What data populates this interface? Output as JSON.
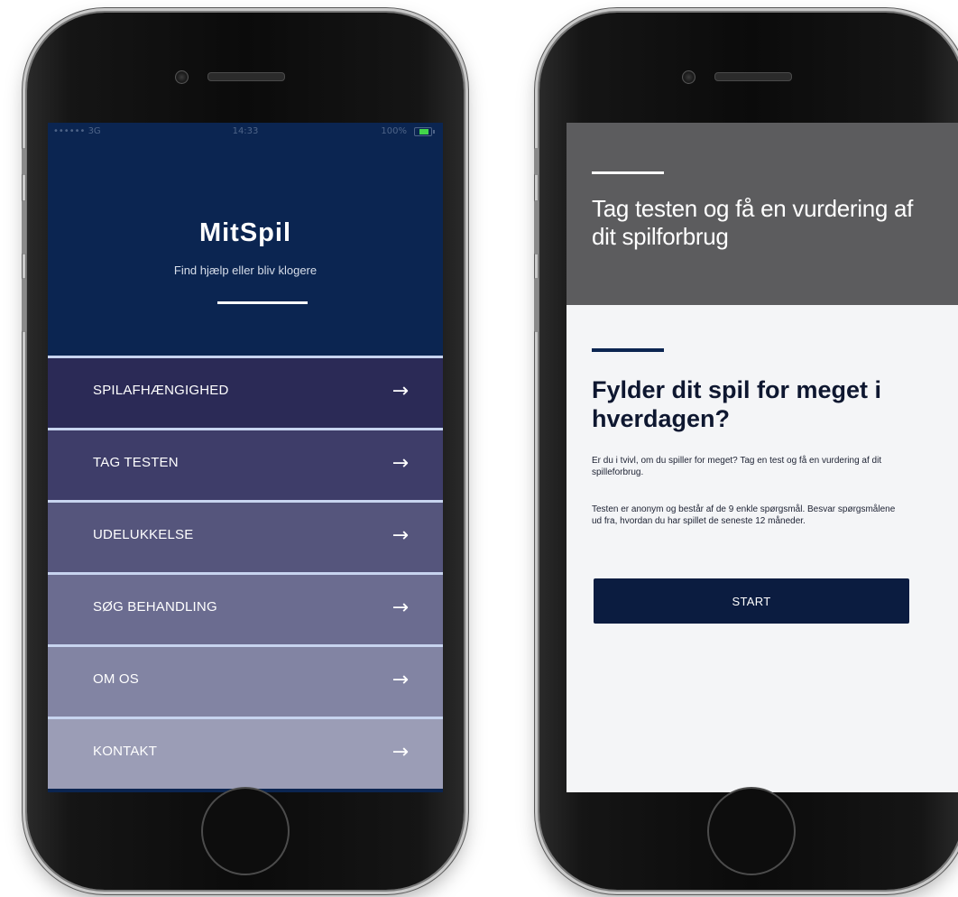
{
  "left_phone": {
    "status_bar": {
      "carrier": "•••••• 3G",
      "time": "14:33",
      "battery_text": "100%"
    },
    "app_title": "MitSpil",
    "app_subtitle": "Find hjælp eller bliv klogere",
    "menu": [
      {
        "label": "SPILAFHÆNGIGHED",
        "arrow": "→",
        "bg": "#2b2a56"
      },
      {
        "label": "TAG TESTEN",
        "arrow": "→",
        "bg": "#3e3d69"
      },
      {
        "label": "UDELUKKELSE",
        "arrow": "→",
        "bg": "#55557c"
      },
      {
        "label": "SØG BEHANDLING",
        "arrow": "→",
        "bg": "#6b6c90"
      },
      {
        "label": "OM OS",
        "arrow": "→",
        "bg": "#8284a3"
      },
      {
        "label": "KONTAKT",
        "arrow": "→",
        "bg": "#9b9db6"
      }
    ]
  },
  "right_phone": {
    "header_title": "Tag testen og få en vurdering af dit spilforbrug",
    "section_heading": "Fylder dit spil for meget i hverdagen?",
    "paragraph_1": "Er du i tvivl, om du spiller for meget? Tag en test og få en vurdering af dit spilleforbrug.",
    "paragraph_2": "Testen er anonym og består af de 9 enkle spørgsmål. Besvar spørgsmålene ud fra, hvordan du har spillet de seneste 12 måneder.",
    "start_label": "START"
  },
  "colors": {
    "navy": "#0b2551",
    "header_grey": "#5c5c5e",
    "button": "#0b1c40",
    "battery_green": "#43d64a"
  }
}
